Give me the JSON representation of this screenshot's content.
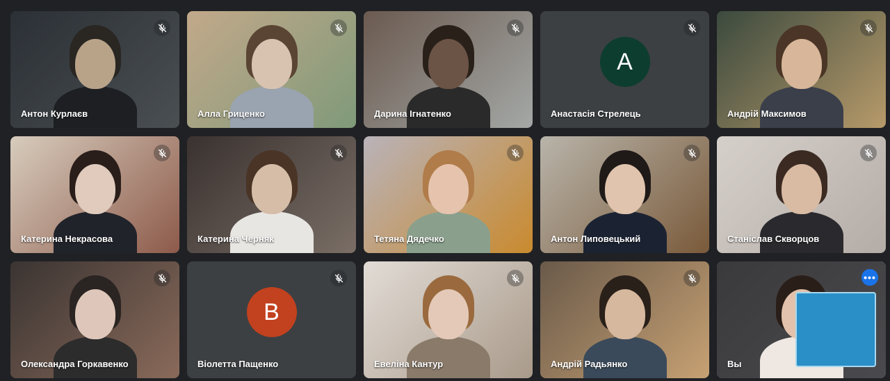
{
  "participants": [
    {
      "name": "Антон Курлаєв",
      "type": "video",
      "muted": true,
      "bg": [
        "#2b3036",
        "#4a4f52"
      ],
      "skin": "#b8a389",
      "hair": "#2a2622",
      "shirt": "#1d1f22"
    },
    {
      "name": "Алла Гриценко",
      "type": "video",
      "muted": true,
      "bg": [
        "#c2a98a",
        "#7f9a7a"
      ],
      "skin": "#d8c3b0",
      "hair": "#5a4433",
      "shirt": "#9aa3b0"
    },
    {
      "name": "Дарина Ігнатенко",
      "type": "video",
      "muted": true,
      "bg": [
        "#6b5a50",
        "#a4a8a6"
      ],
      "skin": "#6b5446",
      "hair": "#2a201a",
      "shirt": "#2a2a2a"
    },
    {
      "name": "Анастасія Стрелець",
      "type": "avatar",
      "muted": true,
      "initial": "A",
      "color": "#0d3d2e"
    },
    {
      "name": "Андрій Максимов",
      "type": "video",
      "muted": true,
      "bg": [
        "#3b4a3e",
        "#b79a6a"
      ],
      "skin": "#d8b699",
      "hair": "#4a3526",
      "shirt": "#3a3f4a"
    },
    {
      "name": "Катерина Некрасова",
      "type": "video",
      "muted": true,
      "bg": [
        "#d7ccbd",
        "#8d5a4a"
      ],
      "skin": "#e0cbbd",
      "hair": "#2a1e1a",
      "shirt": "#20232a"
    },
    {
      "name": "Катерина Черняк",
      "type": "video",
      "muted": true,
      "bg": [
        "#3a3230",
        "#7a6e66"
      ],
      "skin": "#d6bda8",
      "hair": "#4a3426",
      "shirt": "#e8e6e2"
    },
    {
      "name": "Тетяна Дядечко",
      "type": "video",
      "muted": true,
      "bg": [
        "#b9b3ba",
        "#c98a2e"
      ],
      "skin": "#e6c3ad",
      "hair": "#b07c4a",
      "shirt": "#8aa08c"
    },
    {
      "name": "Антон Липовецький",
      "type": "video",
      "muted": true,
      "bg": [
        "#b8b4aa",
        "#7a5a3a"
      ],
      "skin": "#e0c4ad",
      "hair": "#1f1a18",
      "shirt": "#1b2333"
    },
    {
      "name": "Станіслав Скворцов",
      "type": "video",
      "muted": true,
      "bg": [
        "#d6d0cb",
        "#b4aca6"
      ],
      "skin": "#d9bba3",
      "hair": "#3a2a22",
      "shirt": "#2a2a2e"
    },
    {
      "name": "Олександра Горкавенко",
      "type": "video",
      "muted": true,
      "bg": [
        "#3a3432",
        "#8a6a5a"
      ],
      "skin": "#dec7ba",
      "hair": "#2a2422",
      "shirt": "#2c2c2c"
    },
    {
      "name": "Віолетта Пащенко",
      "type": "avatar",
      "muted": true,
      "initial": "В",
      "color": "#c2411f"
    },
    {
      "name": "Евеліна Кантур",
      "type": "video",
      "muted": true,
      "bg": [
        "#e2dcd6",
        "#a99a8a"
      ],
      "skin": "#e4c9b8",
      "hair": "#9a6a3e",
      "shirt": "#8a7a6a"
    },
    {
      "name": "Андрій Радьянко",
      "type": "video",
      "muted": true,
      "bg": [
        "#6a5a4a",
        "#c7a173"
      ],
      "skin": "#d6b89e",
      "hair": "#2a201a",
      "shirt": "#3a4a5a"
    },
    {
      "name": "Вы",
      "type": "self",
      "muted": false,
      "bg": [
        "#3a3a3c",
        "#4a4a4e"
      ],
      "skin": "#e2c2ac",
      "hair": "#2a1e18",
      "shirt": "#efe8e2"
    }
  ],
  "self_tile": {
    "more_label": "•••",
    "accent": "#1a73e8"
  }
}
